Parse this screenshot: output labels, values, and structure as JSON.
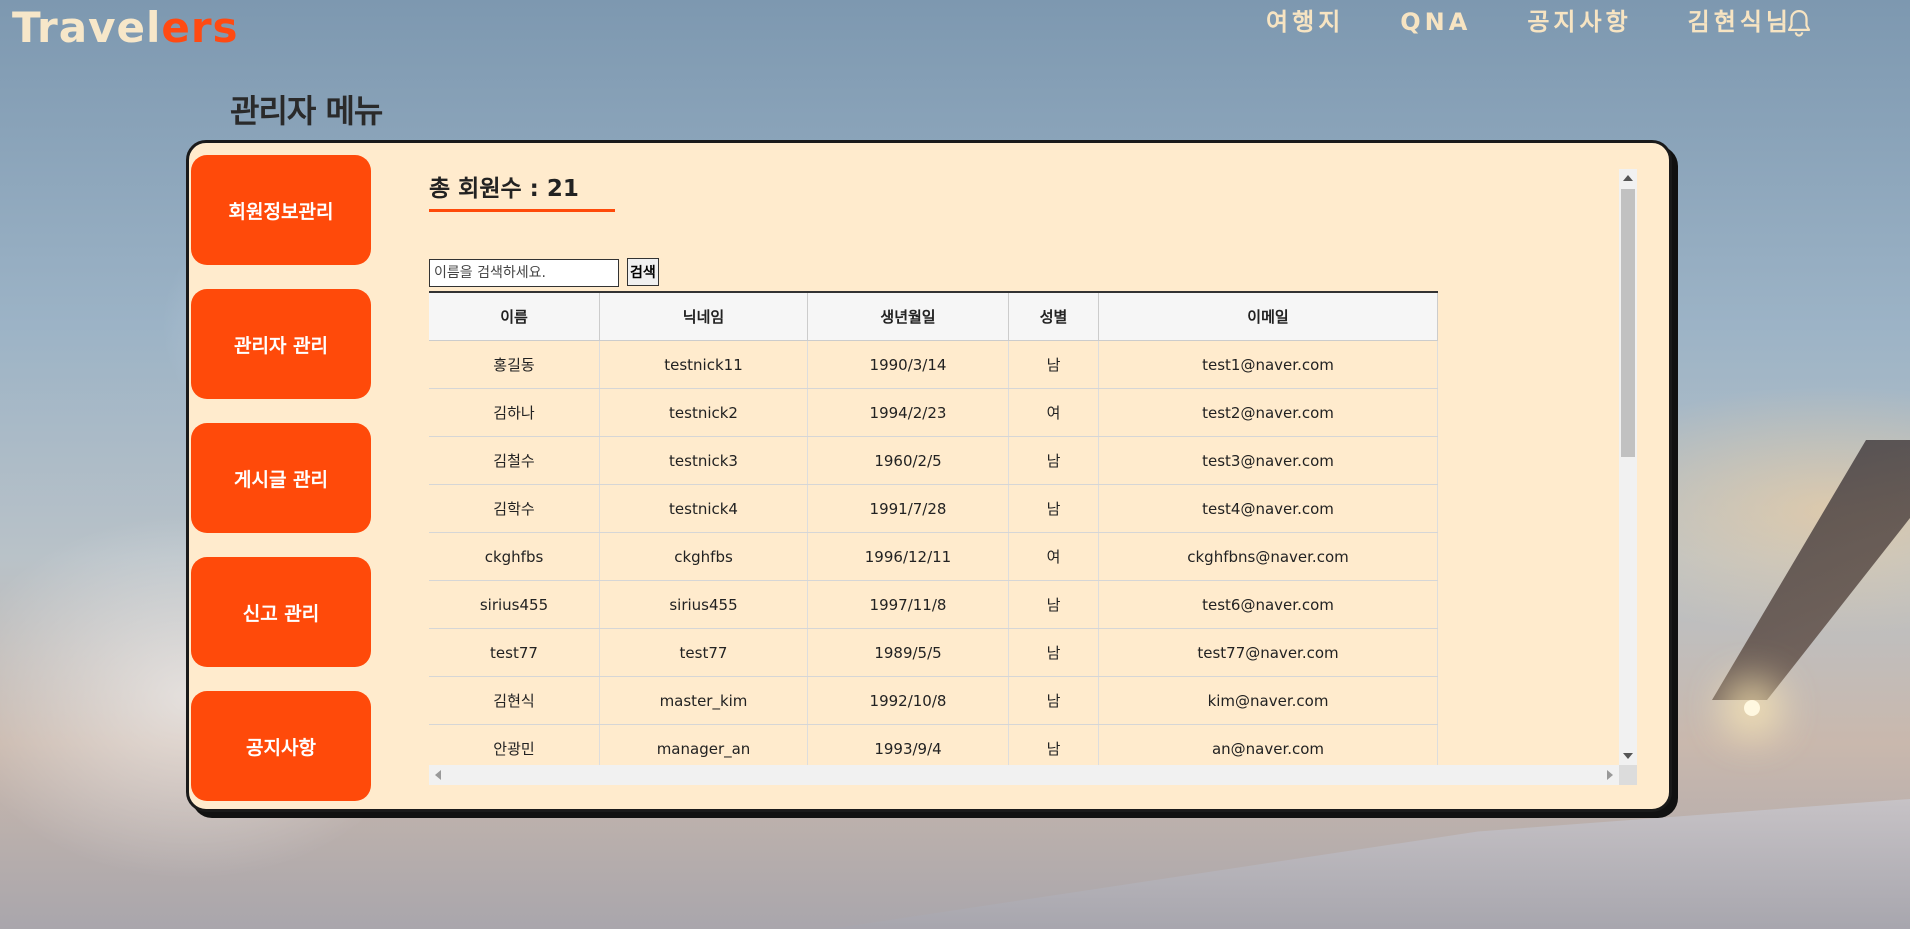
{
  "logo": {
    "part1": "Travel",
    "part2": "ers"
  },
  "nav": {
    "items": [
      "여행지",
      "QNA",
      "공지사항",
      "김현식님"
    ]
  },
  "page_title": "관리자 메뉴",
  "sidebar": {
    "items": [
      {
        "label": "회원정보관리"
      },
      {
        "label": "관리자 관리"
      },
      {
        "label": "게시글 관리"
      },
      {
        "label": "신고 관리"
      },
      {
        "label": "공지사항"
      }
    ]
  },
  "summary": {
    "total_label": "총 회원수 : 21"
  },
  "search": {
    "placeholder": "이름을 검색하세요.",
    "button_label": "검색"
  },
  "table": {
    "headers": [
      "이름",
      "닉네임",
      "생년월일",
      "성별",
      "이메일"
    ],
    "rows": [
      [
        "홍길동",
        "testnick11",
        "1990/3/14",
        "남",
        "test1@naver.com"
      ],
      [
        "김하나",
        "testnick2",
        "1994/2/23",
        "여",
        "test2@naver.com"
      ],
      [
        "김철수",
        "testnick3",
        "1960/2/5",
        "남",
        "test3@naver.com"
      ],
      [
        "김학수",
        "testnick4",
        "1991/7/28",
        "남",
        "test4@naver.com"
      ],
      [
        "ckghfbs",
        "ckghfbs",
        "1996/12/11",
        "여",
        "ckghfbns@naver.com"
      ],
      [
        "sirius455",
        "sirius455",
        "1997/11/8",
        "남",
        "test6@naver.com"
      ],
      [
        "test77",
        "test77",
        "1989/5/5",
        "남",
        "test77@naver.com"
      ],
      [
        "김현식",
        "master_kim",
        "1992/10/8",
        "남",
        "kim@naver.com"
      ],
      [
        "안광민",
        "manager_an",
        "1993/9/4",
        "남",
        "an@naver.com"
      ]
    ]
  },
  "colors": {
    "accent": "#ff4a0a",
    "panel": "#ffebcd",
    "logo_light": "#f7e7c9"
  },
  "icons": {
    "notification": "bell-icon"
  }
}
